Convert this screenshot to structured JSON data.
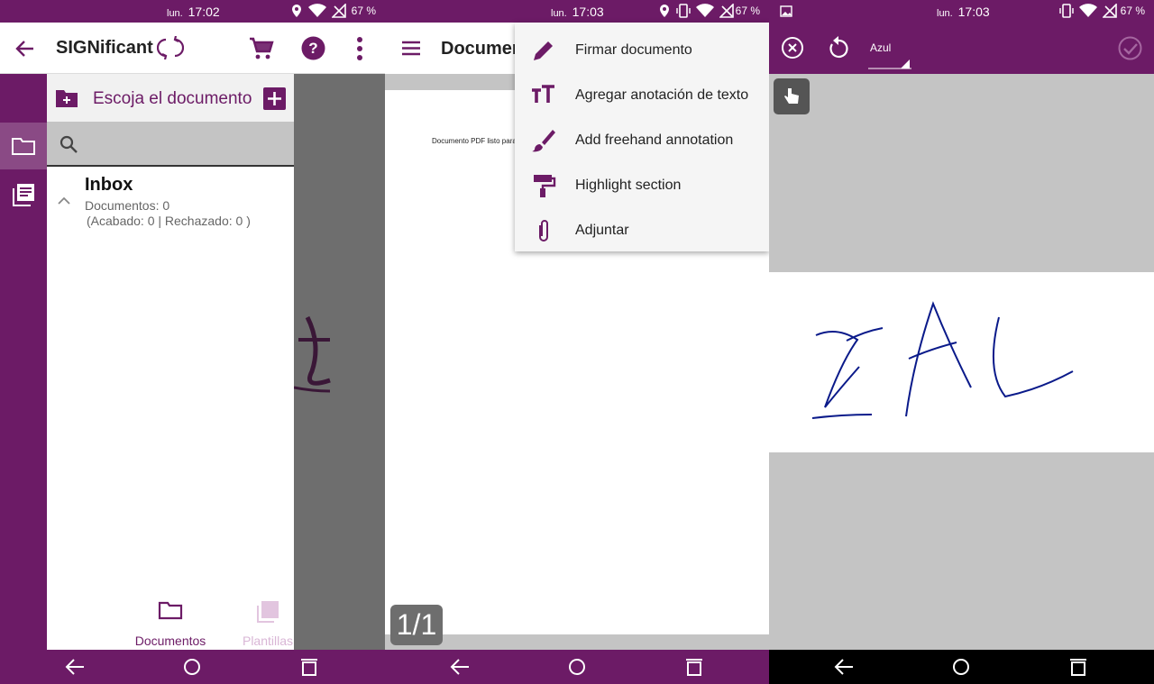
{
  "status_bars": [
    {
      "day": "lun.",
      "time": "17:02",
      "battery": "67 %"
    },
    {
      "day": "lun.",
      "time": "17:03",
      "battery": "67 %"
    },
    {
      "day": "lun.",
      "time": "17:03",
      "battery": "67 %"
    }
  ],
  "panel1": {
    "app_title": "SIGNificant",
    "drawer_header": "Escoja el documento",
    "search_placeholder": "",
    "folder": {
      "title": "Inbox",
      "documents": "Documentos: 0",
      "detail": "(Acabado: 0 | Rechazado: 0 )"
    },
    "tabs": [
      {
        "label": "Documentos",
        "active": true
      },
      {
        "label": "Plantillas",
        "active": false
      }
    ]
  },
  "panel2": {
    "title": "Documen",
    "doc_text": "Documento PDF listo para",
    "pager": "1/1",
    "menu_items": [
      {
        "label": "Firmar documento",
        "icon": "pencil-icon"
      },
      {
        "label": "Agregar anotación de texto",
        "icon": "text-size-icon"
      },
      {
        "label": "Add freehand annotation",
        "icon": "brush-icon"
      },
      {
        "label": "Highlight section",
        "icon": "paint-roller-icon"
      },
      {
        "label": "Adjuntar",
        "icon": "paperclip-icon"
      }
    ]
  },
  "panel3": {
    "color_select": "Azul",
    "signature_text": "ZAL"
  },
  "colors": {
    "brand": "#6c1b66",
    "rail_selected": "#8a4a85",
    "canvas_gray": "#c4c4c4",
    "ink": "#0a1a8a"
  }
}
